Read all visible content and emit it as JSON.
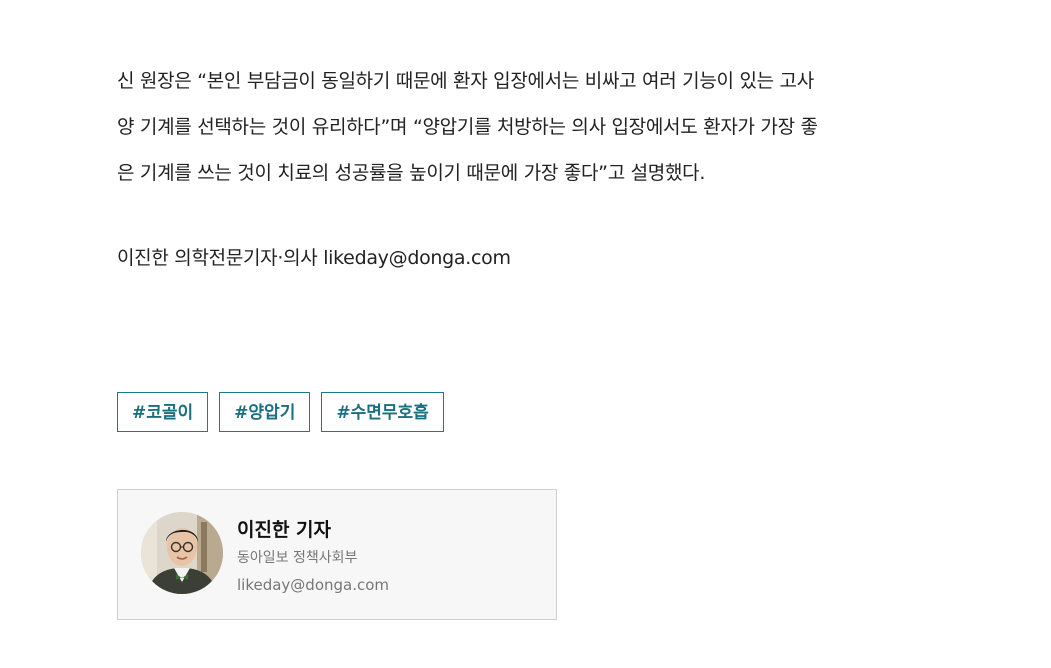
{
  "article": {
    "paragraph_lines": [
      "신 원장은 “본인 부담금이 동일하기 때문에 환자 입장에서는 비싸고 여러 기능이 있는 고사",
      "양 기계를 선택하는 것이 유리하다”며 “양압기를 처방하는 의사 입장에서도 환자가 가장 좋",
      "은 기계를 쓰는 것이 치료의 성공률을 높이기 때문에 가장 좋다”고 설명했다."
    ],
    "byline": "이진한 의학전문기자·의사 likeday@donga.com"
  },
  "tags": [
    {
      "label": "#코골이"
    },
    {
      "label": "#양압기"
    },
    {
      "label": "#수면무호흡"
    }
  ],
  "reporter": {
    "name": "이진한 기자",
    "department": "동아일보 정책사회부",
    "email": "likeday@donga.com"
  },
  "colors": {
    "tag_accent": "#1a6f80",
    "card_background": "#f7f7f7"
  }
}
